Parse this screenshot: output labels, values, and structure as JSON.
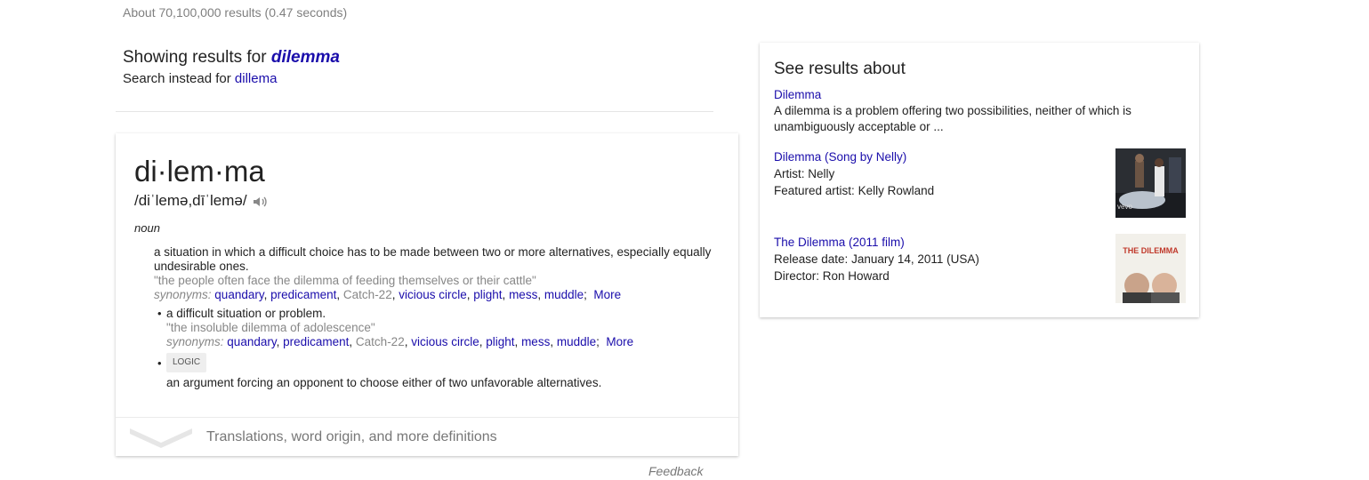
{
  "search": {
    "stats": "About 70,100,000 results (0.47 seconds)",
    "showing_prefix": "Showing results for",
    "corrected_query": "dilemma",
    "search_instead_prefix": "Search instead for",
    "original_query": "dillema"
  },
  "dictionary": {
    "word": "di·lem·ma",
    "pronunciation": "/diˈlemə,dīˈlemə/",
    "audio_icon": "speaker-icon",
    "part_of_speech": "noun",
    "def1": {
      "text": "a situation in which a difficult choice has to be made between two or more alternatives, especially equally undesirable ones.",
      "example": "\"the people often face the dilemma of feeding themselves or their cattle\"",
      "synonyms_label": "synonyms:",
      "synonyms": [
        "quandary",
        "predicament",
        "Catch-22",
        "vicious circle",
        "plight",
        "mess",
        "muddle"
      ],
      "more": "More"
    },
    "def2": {
      "text": "a difficult situation or problem.",
      "example": "\"the insoluble dilemma of adolescence\"",
      "synonyms_label": "synonyms:",
      "synonyms": [
        "quandary",
        "predicament",
        "Catch-22",
        "vicious circle",
        "plight",
        "mess",
        "muddle"
      ],
      "more": "More"
    },
    "def3": {
      "tag": "LOGIC",
      "text": "an argument forcing an opponent to choose either of two unfavorable alternatives."
    },
    "more_definitions": "Translations, word origin, and more definitions"
  },
  "feedback": "Feedback",
  "knowledge_panel": {
    "heading": "See results about",
    "item1": {
      "title": "Dilemma",
      "desc": "A dilemma is a problem offering two possibilities, neither of which is unambiguously acceptable or ..."
    },
    "item2": {
      "title": "Dilemma (Song by Nelly)",
      "label1": "Artist:",
      "value1": "Nelly",
      "label2": "Featured artist:",
      "value2": "Kelly Rowland"
    },
    "item3": {
      "title": "The Dilemma (2011 film)",
      "label1": "Release date:",
      "value1": "January 14, 2011 (USA)",
      "label2": "Director:",
      "value2": "Ron Howard",
      "poster_title": "THE DILEMMA"
    }
  },
  "colors": {
    "link": "#1a0dab",
    "muted": "#878787"
  }
}
